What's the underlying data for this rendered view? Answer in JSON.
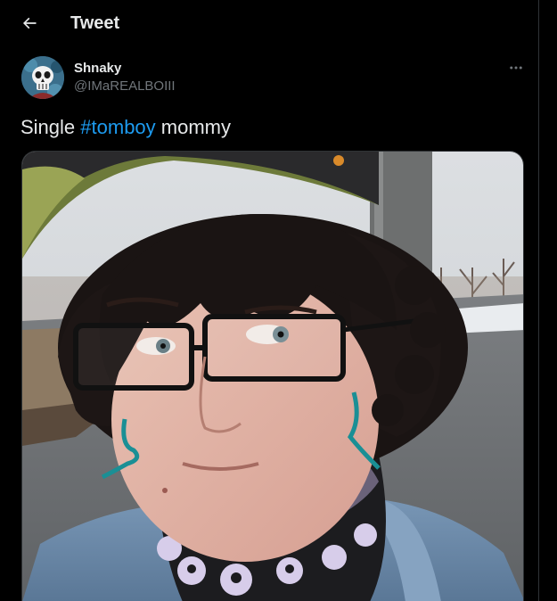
{
  "header": {
    "title": "Tweet",
    "back_icon": "arrow-left-icon"
  },
  "tweet": {
    "author": {
      "display_name": "Shnaky",
      "handle": "@IMaREALBOIII",
      "avatar_icon": "skull-avatar"
    },
    "text_before": "Single ",
    "hashtag": "#tomboy",
    "text_after": " mommy",
    "more_icon": "more-horizontal-icon",
    "media": {
      "kind": "photo",
      "description_icon": "selfie-photo"
    }
  },
  "colors": {
    "background": "#000000",
    "text": "#e7e9ea",
    "secondary_text": "#71767b",
    "accent": "#1d9bf0",
    "border": "#2f3336"
  }
}
